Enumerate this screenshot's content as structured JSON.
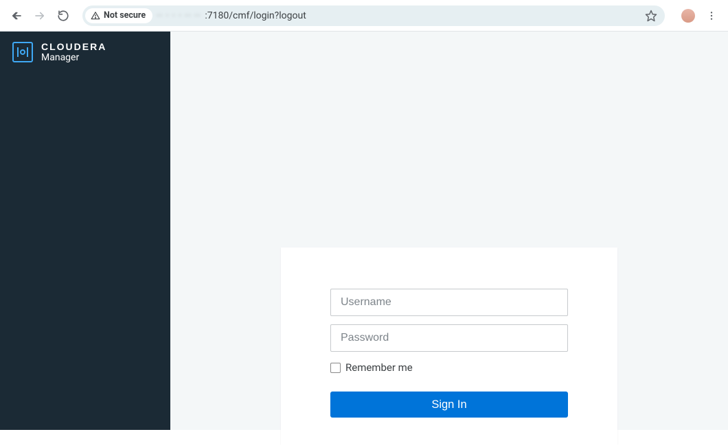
{
  "browser": {
    "security_label": "Not secure",
    "url_obscured": "·· · · · ·· ··",
    "url_visible": ":7180/cmf/login?logout"
  },
  "brand": {
    "title": "CLOUDERA",
    "subtitle": "Manager"
  },
  "login": {
    "username_placeholder": "Username",
    "password_placeholder": "Password",
    "remember_label": "Remember me",
    "signin_label": "Sign In"
  }
}
